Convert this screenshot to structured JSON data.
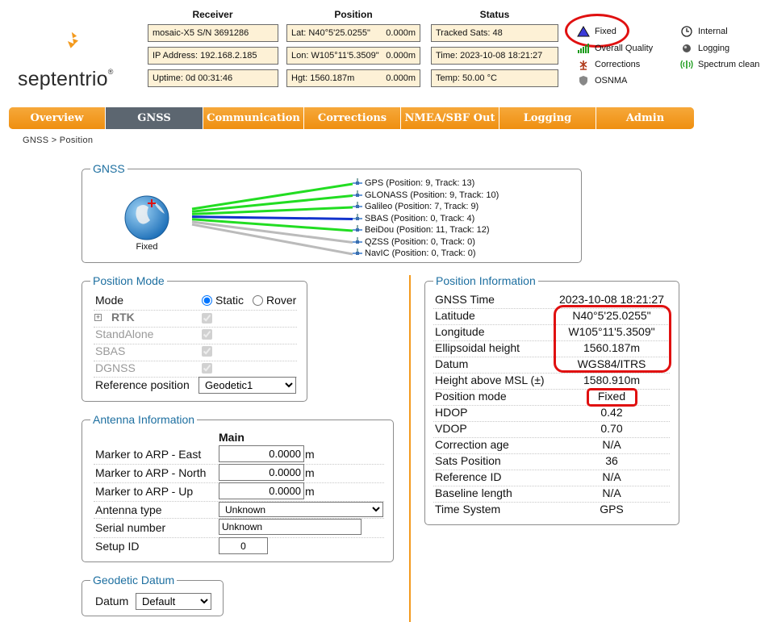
{
  "logo": {
    "text": "septentrio",
    "reg": "®"
  },
  "header": {
    "receiver": {
      "title": "Receiver",
      "model": "mosaic-X5 S/N 3691286",
      "ip": "IP Address: 192.168.2.185",
      "uptime": "Uptime: 0d 00:31:46"
    },
    "position": {
      "title": "Position",
      "lat_label": "Lat:  N40°5'25.0255\"",
      "lat_val": "0.000m",
      "lon_label": "Lon: W105°11'5.3509\"",
      "lon_val": "0.000m",
      "hgt_label": "Hgt: 1560.187m",
      "hgt_val": "0.000m"
    },
    "status": {
      "title": "Status",
      "tracked": "Tracked Sats: 48",
      "time": "Time: 2023-10-08 18:21:27",
      "temp": "Temp: 50.00 °C"
    },
    "indicators": {
      "fixed": "Fixed",
      "overall_quality": "Overall Quality",
      "corrections": "Corrections",
      "osnma": "OSNMA",
      "internal": "Internal",
      "logging": "Logging",
      "spectrum": "Spectrum clean"
    }
  },
  "nav": {
    "tabs": [
      "Overview",
      "GNSS",
      "Communication",
      "Corrections",
      "NMEA/SBF Out",
      "Logging",
      "Admin"
    ],
    "active": "GNSS"
  },
  "breadcrumb": "GNSS > Position",
  "gnss": {
    "legend": "GNSS",
    "globe_label": "Fixed",
    "constellations": [
      {
        "label": "GPS (Position: 9, Track: 13)",
        "color": "#22dd22"
      },
      {
        "label": "GLONASS (Position: 9, Track: 10)",
        "color": "#22dd22"
      },
      {
        "label": "Galileo (Position: 7, Track: 9)",
        "color": "#22dd22"
      },
      {
        "label": "SBAS (Position: 0, Track: 4)",
        "color": "#1133cc"
      },
      {
        "label": "BeiDou (Position: 11, Track: 12)",
        "color": "#22dd22"
      },
      {
        "label": "QZSS (Position: 0, Track: 0)",
        "color": "#bbbbbb"
      },
      {
        "label": "NavIC (Position: 0, Track: 0)",
        "color": "#bbbbbb"
      }
    ]
  },
  "position_mode": {
    "legend": "Position Mode",
    "mode_label": "Mode",
    "static_label": "Static",
    "rover_label": "Rover",
    "rtk": "RTK",
    "standalone": "StandAlone",
    "sbas": "SBAS",
    "dgnss": "DGNSS",
    "ref_label": "Reference position",
    "ref_value": "Geodetic1"
  },
  "antenna": {
    "legend": "Antenna Information",
    "main": "Main",
    "east_label": "Marker to ARP - East",
    "east": "0.0000",
    "north_label": "Marker to ARP - North",
    "north": "0.0000",
    "up_label": "Marker to ARP - Up",
    "up": "0.0000",
    "unit": "m",
    "type_label": "Antenna type",
    "type": "Unknown",
    "serial_label": "Serial number",
    "serial": "Unknown",
    "setup_label": "Setup ID",
    "setup": "0"
  },
  "datum": {
    "legend": "Geodetic Datum",
    "label": "Datum",
    "value": "Default"
  },
  "position_info": {
    "legend": "Position Information",
    "rows": [
      {
        "label": "GNSS Time",
        "value": "2023-10-08 18:21:27"
      },
      {
        "label": "Latitude",
        "value": "N40°5'25.0255\""
      },
      {
        "label": "Longitude",
        "value": "W105°11'5.3509\""
      },
      {
        "label": "Ellipsoidal height",
        "value": "1560.187m"
      },
      {
        "label": "Datum",
        "value": "WGS84/ITRS"
      },
      {
        "label": "Height above MSL (±)",
        "value": "1580.910m"
      },
      {
        "label": "Position mode",
        "value": "Fixed"
      },
      {
        "label": "HDOP",
        "value": "0.42"
      },
      {
        "label": "VDOP",
        "value": "0.70"
      },
      {
        "label": "Correction age",
        "value": "N/A"
      },
      {
        "label": "Sats Position",
        "value": "36"
      },
      {
        "label": "Reference ID",
        "value": "N/A"
      },
      {
        "label": "Baseline length",
        "value": "N/A"
      },
      {
        "label": "Time System",
        "value": "GPS"
      }
    ]
  }
}
